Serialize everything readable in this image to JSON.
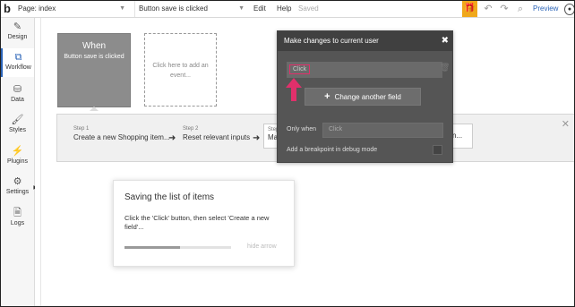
{
  "topbar": {
    "page_label": "Page: index",
    "workflow_label": "Button save is clicked",
    "edit_label": "Edit",
    "help_label": "Help",
    "saved_label": "Saved",
    "preview_label": "Preview"
  },
  "sidebar": {
    "items": [
      {
        "label": "Design",
        "icon": "design-icon"
      },
      {
        "label": "Workflow",
        "icon": "workflow-icon"
      },
      {
        "label": "Data",
        "icon": "database-icon"
      },
      {
        "label": "Styles",
        "icon": "brush-icon"
      },
      {
        "label": "Plugins",
        "icon": "plug-icon"
      },
      {
        "label": "Settings",
        "icon": "gear-icon"
      },
      {
        "label": "Logs",
        "icon": "document-icon"
      }
    ],
    "active": "Workflow"
  },
  "event": {
    "title": "When",
    "subtitle": "Button save is clicked",
    "add_event_text": "Click here to add an event..."
  },
  "steps": [
    {
      "num": "Step 1",
      "text": "Create a new Shopping item..."
    },
    {
      "num": "Step 2",
      "text": "Reset relevant inputs"
    },
    {
      "num": "Step",
      "text": "Ma"
    },
    {
      "num": "",
      "text": "n..."
    }
  ],
  "popover": {
    "title": "Make changes to current user",
    "field_value": "Click",
    "change_button": "Change another field",
    "only_when_label": "Only when",
    "only_when_placeholder": "Click",
    "breakpoint_label": "Add a breakpoint in debug mode"
  },
  "tooltip": {
    "title": "Saving the list of items",
    "body": "Click the 'Click' button, then select 'Create a new field'...",
    "hide_label": "hide arrow",
    "progress": 0.52
  },
  "colors": {
    "accent": "#2a63b7",
    "gift": "#f0a81b",
    "highlight": "#e0306b"
  }
}
